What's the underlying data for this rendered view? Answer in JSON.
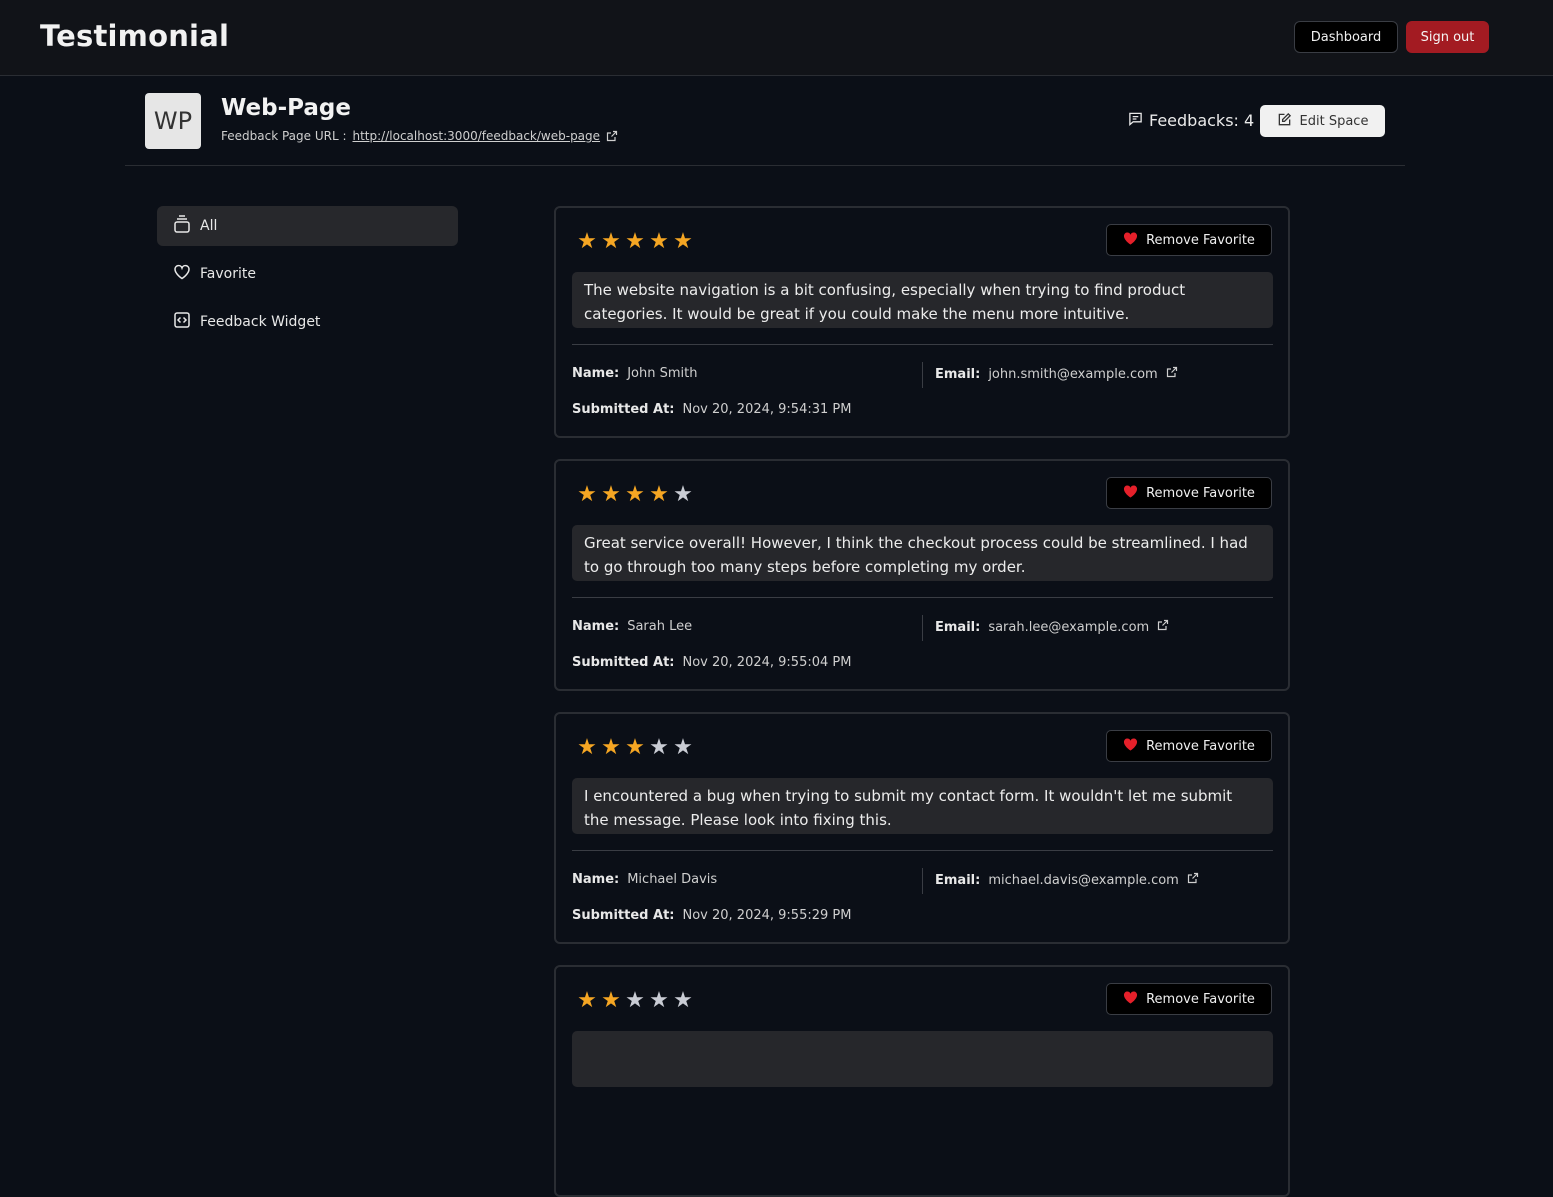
{
  "header": {
    "brand": "Testimonial",
    "dashboard_label": "Dashboard",
    "signout_label": "Sign out"
  },
  "space": {
    "avatar_initials": "WP",
    "title": "Web-Page",
    "url_label": "Feedback Page URL :",
    "url": "http://localhost:3000/feedback/web-page",
    "feedback_count_label": "Feedbacks: 4",
    "edit_label": "Edit Space"
  },
  "sidebar": {
    "items": [
      {
        "label": "All",
        "icon": "stack-icon",
        "active": true
      },
      {
        "label": "Favorite",
        "icon": "heart-outline-icon",
        "active": false
      },
      {
        "label": "Feedback Widget",
        "icon": "code-icon",
        "active": false
      }
    ]
  },
  "colors": {
    "star_on": "#f5a623",
    "star_off": "#c9ccd4",
    "heart": "#e5202a",
    "signout": "#a31b22"
  },
  "feedbacks": [
    {
      "rating": 5,
      "fav_label": "Remove Favorite",
      "message": "The website navigation is a bit confusing, especially when trying to find product categories. It would be great if you could make the menu more intuitive.",
      "name_key": "Name:",
      "name": "John Smith",
      "email_key": "Email:",
      "email": "john.smith@example.com",
      "date_key": "Submitted At:",
      "date": "Nov 20, 2024, 9:54:31 PM"
    },
    {
      "rating": 4,
      "fav_label": "Remove Favorite",
      "message": "Great service overall! However, I think the checkout process could be streamlined. I had to go through too many steps before completing my order.",
      "name_key": "Name:",
      "name": "Sarah Lee",
      "email_key": "Email:",
      "email": "sarah.lee@example.com",
      "date_key": "Submitted At:",
      "date": "Nov 20, 2024, 9:55:04 PM"
    },
    {
      "rating": 3,
      "fav_label": "Remove Favorite",
      "message": "I encountered a bug when trying to submit my contact form. It wouldn't let me submit the message. Please look into fixing this.",
      "name_key": "Name:",
      "name": "Michael Davis",
      "email_key": "Email:",
      "email": "michael.davis@example.com",
      "date_key": "Submitted At:",
      "date": "Nov 20, 2024, 9:55:29 PM"
    },
    {
      "rating": 2,
      "fav_label": "Remove Favorite",
      "message": "",
      "name_key": "",
      "name": "",
      "email_key": "",
      "email": "",
      "date_key": "",
      "date": ""
    }
  ]
}
